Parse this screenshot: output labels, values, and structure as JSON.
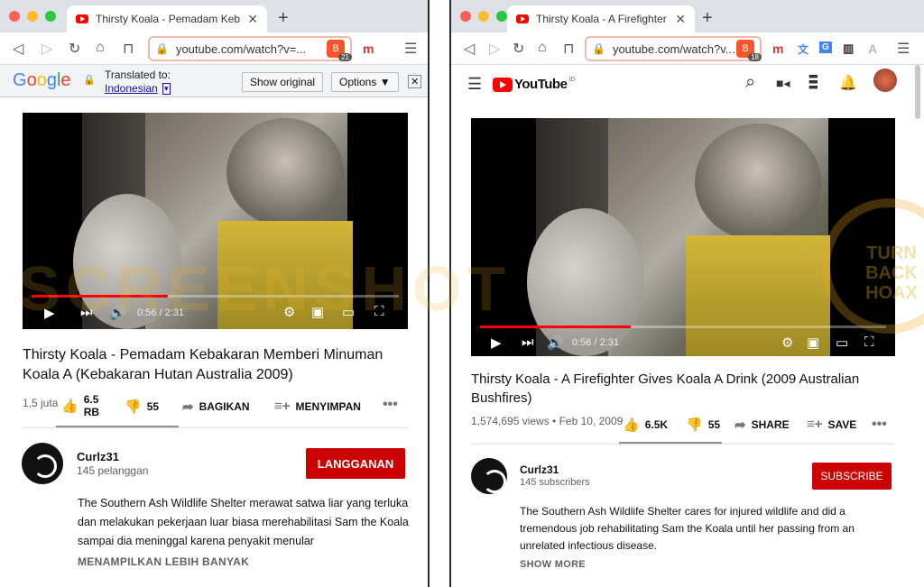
{
  "left": {
    "tab_title": "Thirsty Koala - Pemadam Kebakar",
    "url": "youtube.com/watch?v=...",
    "brave_count": "21",
    "translate": {
      "logo": "Google",
      "translated_to": "Translated to:",
      "language": "Indonesian",
      "show_original": "Show original",
      "options": "Options ▼"
    },
    "video": {
      "time": "0:56 / 2:31",
      "progress": 0.37,
      "title": "Thirsty Koala - Pemadam Kebakaran Memberi Minuman Koala A (Kebakaran Hutan Australia 2009)",
      "views": "1,5 juta",
      "likes": "6.5 RB",
      "dislikes": "55",
      "share": "BAGIKAN",
      "save": "MENYIMPAN"
    },
    "channel": {
      "name": "Curlz31",
      "subscribers": "145 pelanggan",
      "subscribe": "LANGGANAN"
    },
    "description": "The Southern Ash Wildlife Shelter merawat satwa liar yang terluka dan melakukan pekerjaan luar biasa merehabilitasi Sam the Koala sampai dia meninggal karena penyakit menular",
    "show_more": "MENAMPILKAN LEBIH BANYAK"
  },
  "right": {
    "tab_title": "Thirsty Koala - A Firefighter Gives",
    "url": "youtube.com/watch?v...",
    "brave_count": "18",
    "logo": "YouTube",
    "logo_region": "ID",
    "video": {
      "time": "0:56 / 2:31",
      "progress": 0.37,
      "title": "Thirsty Koala - A Firefighter Gives Koala A Drink (2009 Australian Bushfires)",
      "views": "1,574,695 views • Feb 10, 2009",
      "likes": "6.5K",
      "dislikes": "55",
      "share": "SHARE",
      "save": "SAVE"
    },
    "channel": {
      "name": "Curlz31",
      "subscribers": "145 subscribers",
      "subscribe": "SUBSCRIBE"
    },
    "description": "The Southern Ash Wildlife Shelter cares for injured wildlife and did a tremendous job rehabilitating Sam the Koala until her passing from an unrelated infectious disease.",
    "show_more": "SHOW MORE"
  },
  "watermark": "SCREENSHOT",
  "seal_text": "TURN BACK HOAX",
  "icons": {
    "menu": "☰",
    "search": "⌕",
    "bell": "🔔",
    "apps": "⋮⋮⋮",
    "camera": "📹"
  }
}
